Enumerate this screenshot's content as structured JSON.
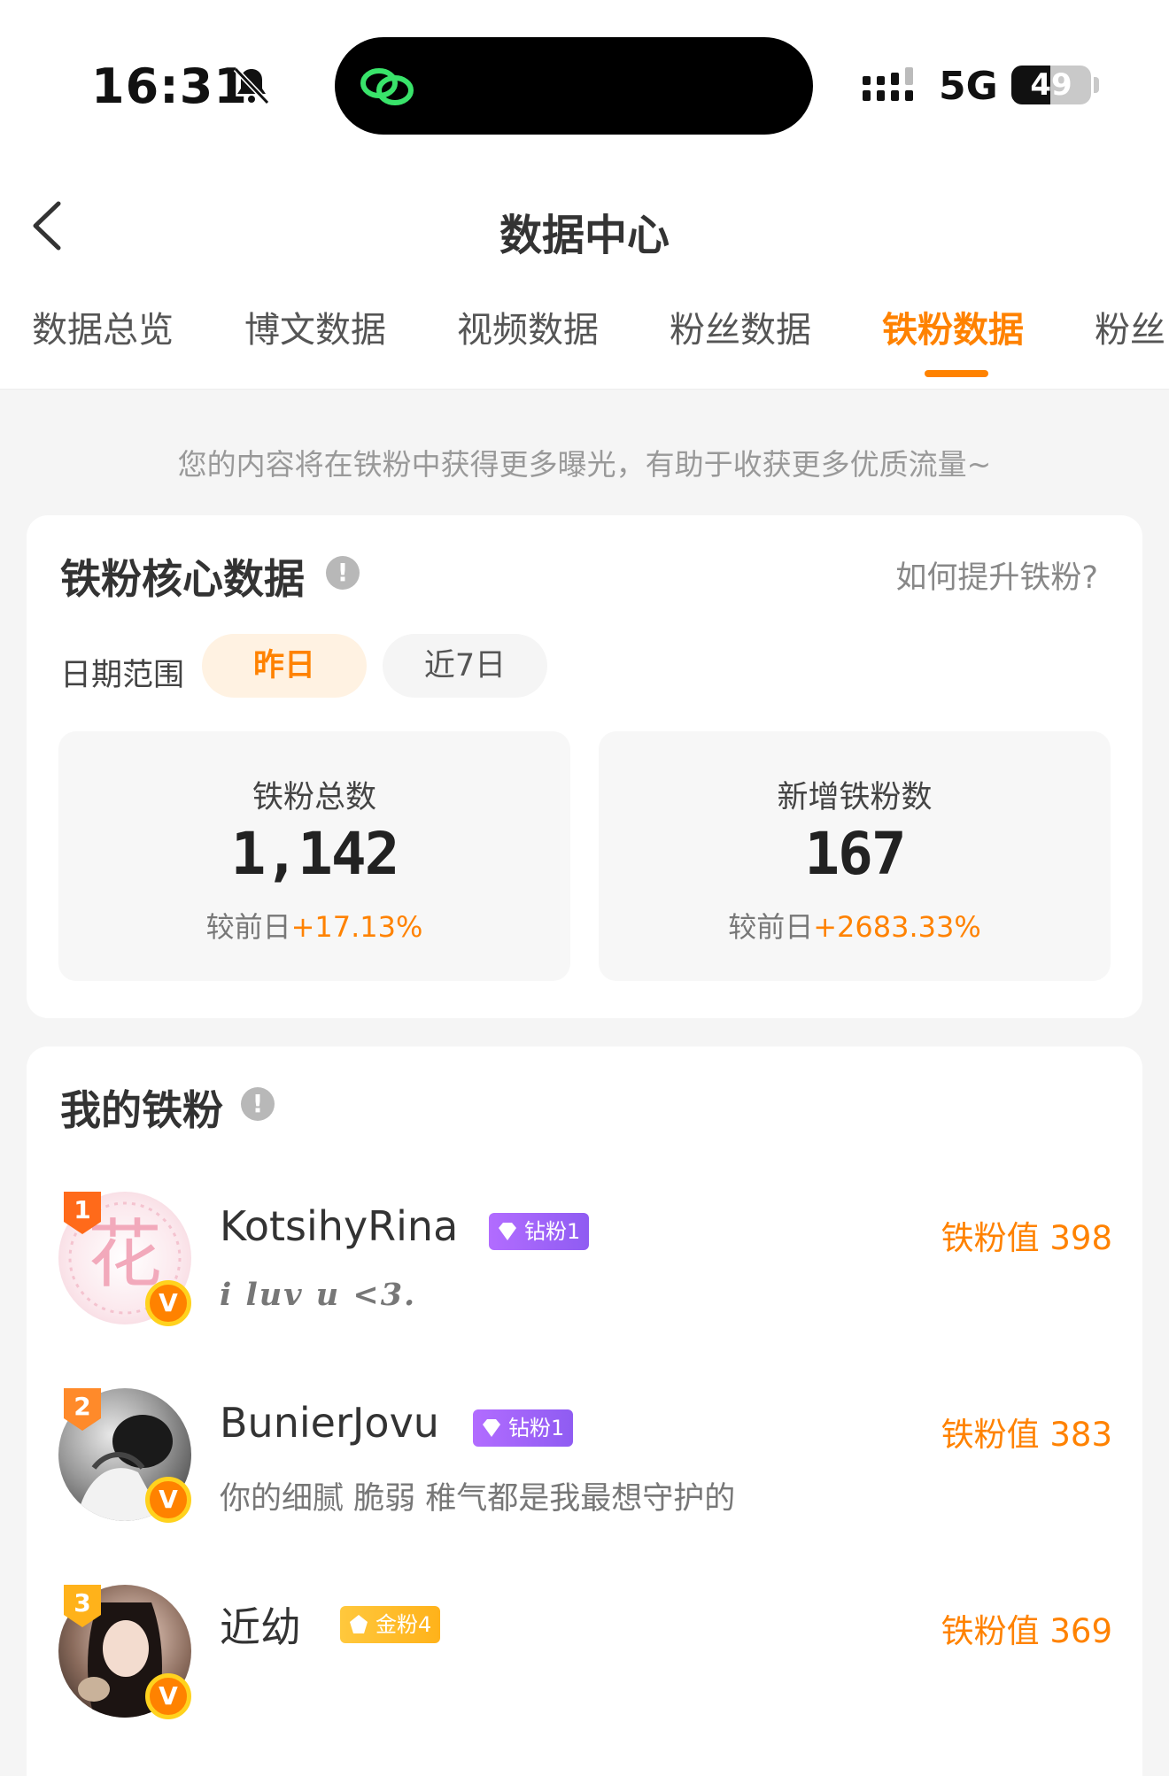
{
  "status_bar": {
    "time": "16:31",
    "network": "5G",
    "battery": "49",
    "battery_level": 0.49
  },
  "header": {
    "title": "数据中心",
    "tabs": [
      {
        "label": "数据总览"
      },
      {
        "label": "博文数据"
      },
      {
        "label": "视频数据"
      },
      {
        "label": "粉丝数据"
      },
      {
        "label": "铁粉数据"
      },
      {
        "label": "粉丝"
      }
    ],
    "active_tab": "铁粉数据"
  },
  "notice": "您的内容将在铁粉中获得更多曝光，有助于收获更多优质流量~",
  "core_card": {
    "title": "铁粉核心数据",
    "how_link": "如何提升铁粉?",
    "date_range_label": "日期范围",
    "range_options": [
      "昨日",
      "近7日"
    ],
    "selected_range": "昨日",
    "stats": [
      {
        "label": "铁粉总数",
        "value": "1,142",
        "compare_prefix": "较前日",
        "compare_value": "+17.13%"
      },
      {
        "label": "新增铁粉数",
        "value": "167",
        "compare_prefix": "较前日",
        "compare_value": "+2683.33%"
      }
    ]
  },
  "fans_card": {
    "title": "我的铁粉",
    "fans": [
      {
        "rank": "1",
        "name": "KotsihyRina",
        "badge": "钻粉1",
        "badge_type": "diamond",
        "bio": "i luv u <3.",
        "score": "铁粉值 398",
        "avatar_char": "花"
      },
      {
        "rank": "2",
        "name": "BunierJovu",
        "badge": "钻粉1",
        "badge_type": "diamond",
        "bio": "你的细腻 脆弱 稚气都是我最想守护的",
        "score": "铁粉值 383"
      },
      {
        "rank": "3",
        "name": "近幼",
        "badge": "金粉4",
        "badge_type": "gold",
        "bio": "",
        "score": "铁粉值 369"
      }
    ]
  },
  "colors": {
    "accent": "#ff8200",
    "diamond_badge": "#a064f8",
    "gold_badge": "#ffbc2a",
    "verified_ring": "#ffd21e"
  },
  "icons": [
    "bell-slash-icon",
    "link-icon",
    "signal-icon",
    "battery-icon",
    "back-chevron-icon",
    "info-icon",
    "rank-badge-icon",
    "verified-v-icon",
    "diamond-gem-icon",
    "gold-gem-icon"
  ]
}
